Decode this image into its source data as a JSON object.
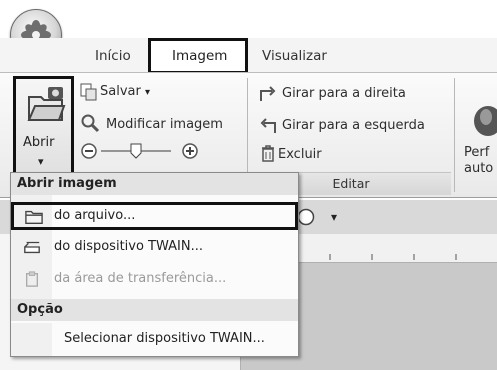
{
  "tabs": [
    {
      "label": "Início"
    },
    {
      "label": "Imagem"
    },
    {
      "label": "Visualizar"
    }
  ],
  "ribbon": {
    "open_button": {
      "label": "Abrir",
      "dropdown_arrow": "▾"
    },
    "save": {
      "label": "Salvar",
      "arrow": "▾"
    },
    "modify": {
      "label": "Modificar imagem"
    },
    "rotate_right": {
      "label": "Girar para a direita"
    },
    "rotate_left": {
      "label": "Girar para a esquerda"
    },
    "delete": {
      "label": "Excluir"
    },
    "edit_group_caption": "Editar",
    "profile_partial": {
      "line1": "Perf",
      "line2": "auto"
    }
  },
  "toolbar_strip": {
    "dropdown_glyph": "▾"
  },
  "menu": {
    "header_open": "Abrir imagem",
    "items": [
      {
        "label": "do arquivo...",
        "icon": "folder-icon",
        "enabled": true,
        "selected": true
      },
      {
        "label": "do dispositivo TWAIN...",
        "icon": "scanner-icon",
        "enabled": true,
        "selected": false
      },
      {
        "label": "da área de transferência...",
        "icon": "clipboard-icon",
        "enabled": false,
        "selected": false
      }
    ],
    "header_option": "Opção",
    "option_items": [
      {
        "label": "Selecionar dispositivo TWAIN..."
      }
    ]
  },
  "colors": {
    "selection_outline": "#111111",
    "disabled_text": "#9a9a9a"
  }
}
